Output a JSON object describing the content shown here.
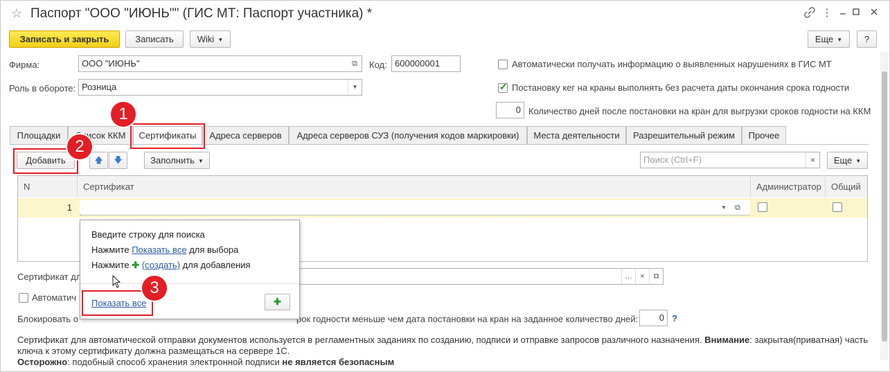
{
  "window": {
    "title": "Паспорт \"ООО \"ИЮНЬ\"\" (ГИС МТ: Паспорт участника) *",
    "icons": [
      "link-icon",
      "menu-icon",
      "maximize-icon",
      "close-icon"
    ]
  },
  "toolbar": {
    "save_close": "Записать и закрыть",
    "save": "Записать",
    "wiki": "Wiki",
    "more": "Еще",
    "help": "?"
  },
  "form": {
    "firm_label": "Фирма:",
    "firm_value": "ООО \"ИЮНЬ\"",
    "code_label": "Код:",
    "code_value": "600000001",
    "role_label": "Роль в обороте:",
    "role_value": "Розница",
    "auto_violations_label": "Автоматически получать информацию о выявленных нарушениях в ГИС МТ",
    "auto_violations_checked": false,
    "kegs_label": "Постановку кег на краны выполнять без расчета даты окончания срока годности",
    "kegs_checked": true,
    "days_value": "0",
    "days_label": "Количество дней после постановки на кран для выгрузки сроков годности на ККМ"
  },
  "tabs": [
    {
      "label": "Площадки",
      "active": false
    },
    {
      "label": "Список ККМ",
      "active": false
    },
    {
      "label": "Сертификаты",
      "active": true
    },
    {
      "label": "Адреса серверов",
      "active": false
    },
    {
      "label": "Адреса серверов СУЗ (получения кодов маркировки)",
      "active": false
    },
    {
      "label": "Места деятельности",
      "active": false
    },
    {
      "label": "Разрешительный режим",
      "active": false
    },
    {
      "label": "Прочее",
      "active": false
    }
  ],
  "certs": {
    "add": "Добавить",
    "fill": "Заполнить",
    "search_placeholder": "Поиск (Ctrl+F)",
    "more": "Еще",
    "columns": [
      "N",
      "Сертификат",
      "Администратор",
      "Общий"
    ],
    "rows": [
      {
        "n": "1",
        "cert": "",
        "admin": false,
        "common": false
      }
    ]
  },
  "popup": {
    "line1": "Введите строку для поиска",
    "line2_pre": "Нажмите",
    "line2_link": "Показать все",
    "line2_post": "для выбора",
    "line3_pre": "Нажмите",
    "line3_link": "(создать)",
    "line3_post": "для добавления",
    "show_all": "Показать все",
    "plus": "+"
  },
  "lower": {
    "cert_label": "Сертификат дл",
    "auto_label": "Автоматич",
    "block_pre": "Блокировать о",
    "block_post": "рок годности меньше чем дата постановки на кран на заданное количество дней:",
    "block_days": "0",
    "help_q": "?"
  },
  "footer": {
    "line1_pre": "Сертификат для автоматической отправки документов используется в регламентных заданиях по созданию, подписи и отправке запросов различного назначения.",
    "attention": "Внимание",
    "line1_post": ": закрытая(приватная) часть",
    "line2": "ключа к этому сертификату должна размещаться на сервере 1С.",
    "caution": "Осторожно",
    "line3_mid": ": подобный способ хранения электронной подписи",
    "line3_bold": "не является безопасным"
  },
  "callouts": [
    "1",
    "2",
    "3"
  ],
  "colors": {
    "accent_yellow": "#f2cf1a",
    "callout_red": "#e31e24",
    "link_blue": "#2a5ca8",
    "plus_green": "#2c9a3a",
    "row_highlight": "#fcf6cc"
  }
}
